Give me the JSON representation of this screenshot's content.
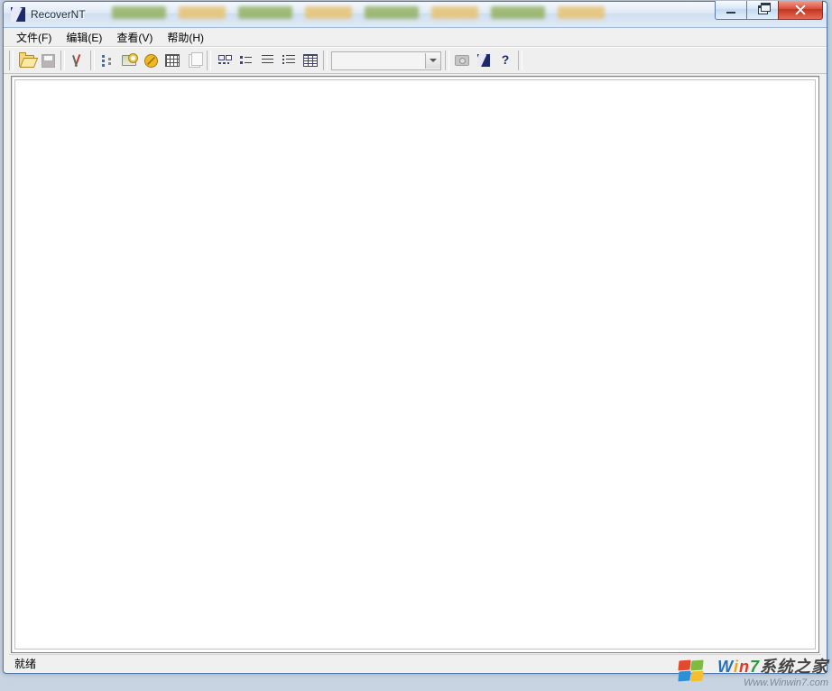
{
  "title": "RecoverNT",
  "menu": {
    "file": "文件(F)",
    "edit": "编辑(E)",
    "view": "查看(V)",
    "help": "帮助(H)"
  },
  "toolbar": {
    "open": "open",
    "save": "save",
    "tools": "tools",
    "tree": "tree",
    "scandrive": "scan-drive",
    "noentry": "stop",
    "grid": "grid",
    "copy": "copy",
    "lgicons": "large-icons",
    "smicons": "small-icons",
    "list": "list",
    "list2": "list-2",
    "details": "details",
    "combo_value": "",
    "camera": "camera",
    "appicon": "recovernt",
    "help": "?"
  },
  "status": {
    "ready": "就绪"
  },
  "watermark": {
    "line1_w": "W",
    "line1_i": "i",
    "line1_n": "n",
    "line1_7": "7",
    "line1_rest": "系统之家",
    "line2": "Www.Winwin7.com"
  }
}
